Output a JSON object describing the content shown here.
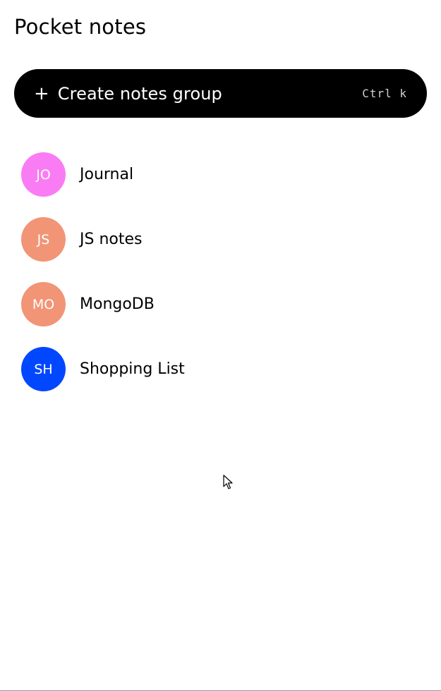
{
  "app": {
    "title": "Pocket notes"
  },
  "create_button": {
    "icon": "plus-icon",
    "icon_glyph": "+",
    "label": "Create notes group",
    "shortcut": "Ctrl k"
  },
  "groups": [
    {
      "initials": "JO",
      "name": "Journal",
      "color": "#FA7CF4"
    },
    {
      "initials": "JS",
      "name": "JS notes",
      "color": "#F19576"
    },
    {
      "initials": "MO",
      "name": "MongoDB",
      "color": "#F19576"
    },
    {
      "initials": "SH",
      "name": "Shopping List",
      "color": "#0047FF"
    }
  ]
}
